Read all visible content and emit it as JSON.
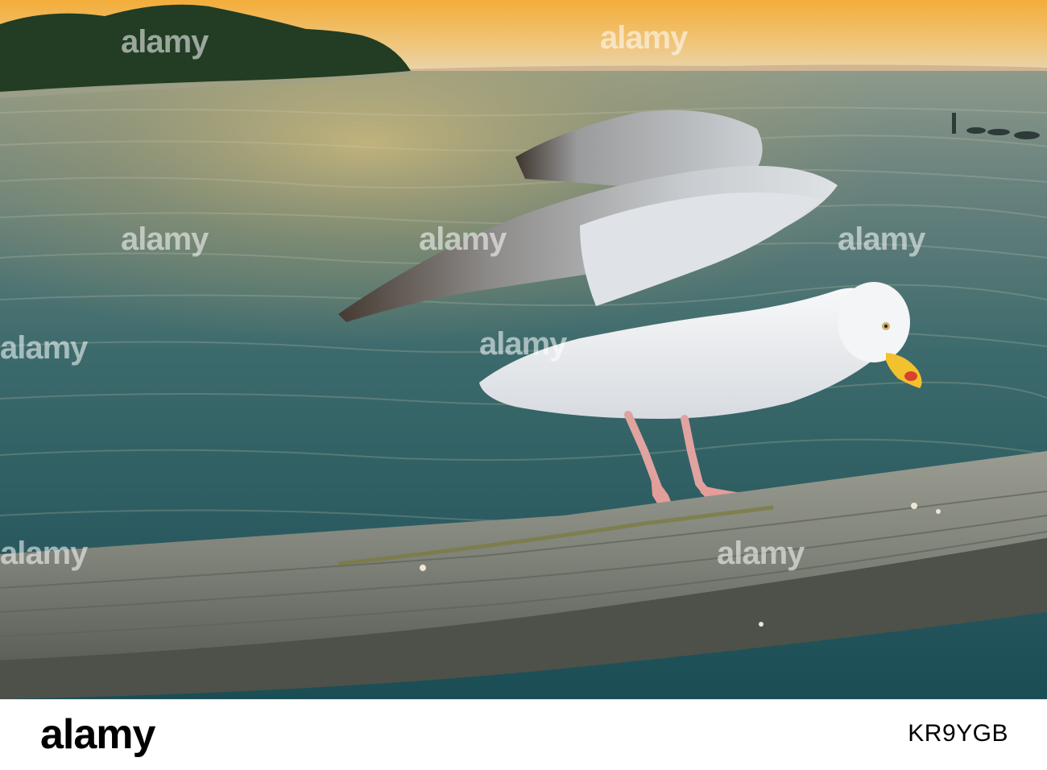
{
  "image": {
    "description_colors": {
      "sky_top": "#f2b84a",
      "sky_horizon": "#e9c893",
      "sea_dark": "#1f4d55",
      "sea_glow": "#b9a66b",
      "cliff": "#1f3a22",
      "rail_wood": "#7c7f74",
      "gull_white": "#f2f3f4",
      "wing_grey": "#bfc4c9",
      "wing_tip": "#4a3f37",
      "beak_yellow": "#f2c12e",
      "beak_spot": "#d8412b",
      "legs_pink": "#e1a3a0"
    }
  },
  "watermark": {
    "text": "alamy"
  },
  "footer": {
    "logo_text": "alamy",
    "image_id": "KR9YGB"
  }
}
